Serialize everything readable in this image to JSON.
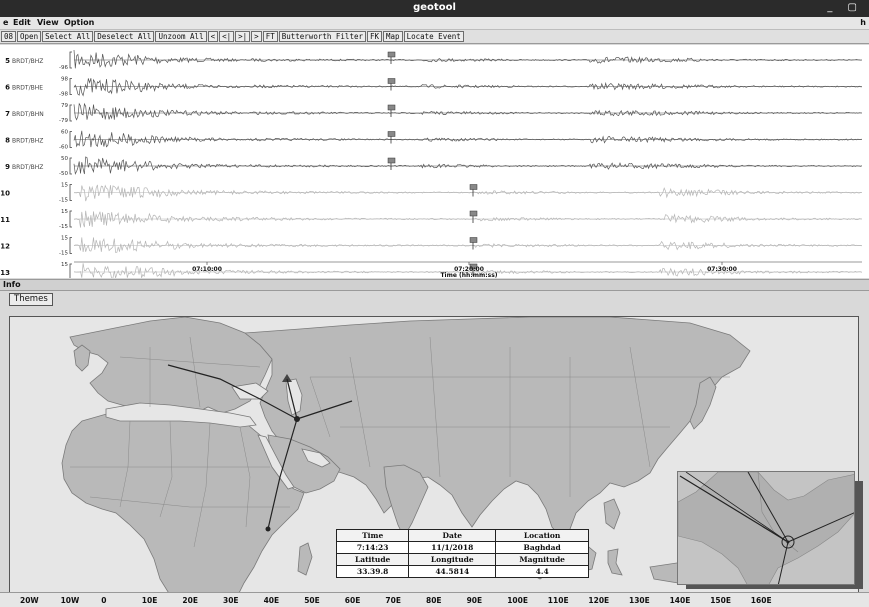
{
  "window": {
    "title": "geotool"
  },
  "menu": {
    "items": [
      "e",
      "Edit",
      "View",
      "Option"
    ],
    "help": "h"
  },
  "toolbar": {
    "buttons": [
      "08",
      "Open",
      "Select All",
      "Deselect All",
      "Unzoom All",
      "<",
      "<|",
      ">|",
      ">",
      "FT",
      "Butterworth Filter",
      "FK",
      "Map",
      "Locate Event"
    ]
  },
  "traces": {
    "rows": [
      {
        "num": "5",
        "station": "BRDT/BHZ",
        "max": "",
        "min": "-96",
        "group": "dark"
      },
      {
        "num": "6",
        "station": "BRDT/BHE",
        "max": "98",
        "min": "-98",
        "group": "dark"
      },
      {
        "num": "7",
        "station": "BRDT/BHN",
        "max": "79",
        "min": "-79",
        "group": "dark"
      },
      {
        "num": "8",
        "station": "BRDT/BHZ",
        "max": "60",
        "min": "-60",
        "group": "dark"
      },
      {
        "num": "9",
        "station": "BRDT/BHZ",
        "max": "50",
        "min": "-50",
        "group": "dark"
      },
      {
        "num": "10",
        "station": "",
        "max": "15",
        "min": "-15",
        "group": "light"
      },
      {
        "num": "11",
        "station": "",
        "max": "15",
        "min": "-15",
        "group": "light"
      },
      {
        "num": "12",
        "station": "",
        "max": "15",
        "min": "-15",
        "group": "light"
      },
      {
        "num": "13",
        "station": "",
        "max": "15",
        "min": "",
        "group": "light"
      }
    ],
    "time_ticks": [
      "07:10:00",
      "07:20:00",
      "07:30:00"
    ],
    "time_label": "Time (hh:mm:ss)"
  },
  "status": {
    "text": "Info"
  },
  "map": {
    "tab_label": "Themes",
    "lon_labels": [
      "20W",
      "10W",
      "0",
      "10E",
      "20E",
      "30E",
      "40E",
      "50E",
      "60E",
      "70E",
      "80E",
      "90E",
      "100E",
      "110E",
      "120E",
      "130E",
      "140E",
      "150E",
      "160E"
    ]
  },
  "event": {
    "headers1": [
      "Time",
      "Date",
      "Location"
    ],
    "values1": [
      "7:14:23",
      "11/1/2018",
      "Baghdad"
    ],
    "headers2": [
      "Latitude",
      "Longitude",
      "Magnitude"
    ],
    "values2": [
      "33.39.8",
      "44.5814",
      "4.4"
    ]
  },
  "colors": {
    "titlebar": "#2b2b2b",
    "land": "#b9b9b9",
    "sea": "#e6e6e6",
    "trace_dark": "#555555",
    "trace_light": "#b5b5b5"
  }
}
